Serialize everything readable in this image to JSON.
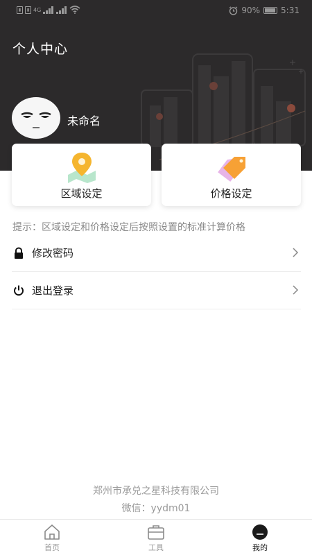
{
  "status_bar": {
    "sim1": "4G",
    "battery": "90%",
    "time": "5:31"
  },
  "header": {
    "title": "个人中心",
    "username": "未命名"
  },
  "cards": [
    {
      "label": "区域设定",
      "icon": "map-pin-icon"
    },
    {
      "label": "价格设定",
      "icon": "price-tag-icon"
    }
  ],
  "hint": "提示：区域设定和价格设定后按照设置的标准计算价格",
  "menu": [
    {
      "label": "修改密码",
      "icon": "lock-icon"
    },
    {
      "label": "退出登录",
      "icon": "power-icon"
    }
  ],
  "footer": {
    "company": "郑州市承兑之星科技有限公司",
    "wechat": "微信：yydm01"
  },
  "tabbar": [
    {
      "label": "首页",
      "icon": "home-icon",
      "active": false
    },
    {
      "label": "工具",
      "icon": "toolbox-icon",
      "active": false
    },
    {
      "label": "我的",
      "icon": "profile-icon",
      "active": true
    }
  ],
  "colors": {
    "header_bg": "#2c2a2b",
    "pin_yellow": "#f5b52e",
    "tag_orange": "#f7a135",
    "text_gray": "#9a9a9a"
  }
}
